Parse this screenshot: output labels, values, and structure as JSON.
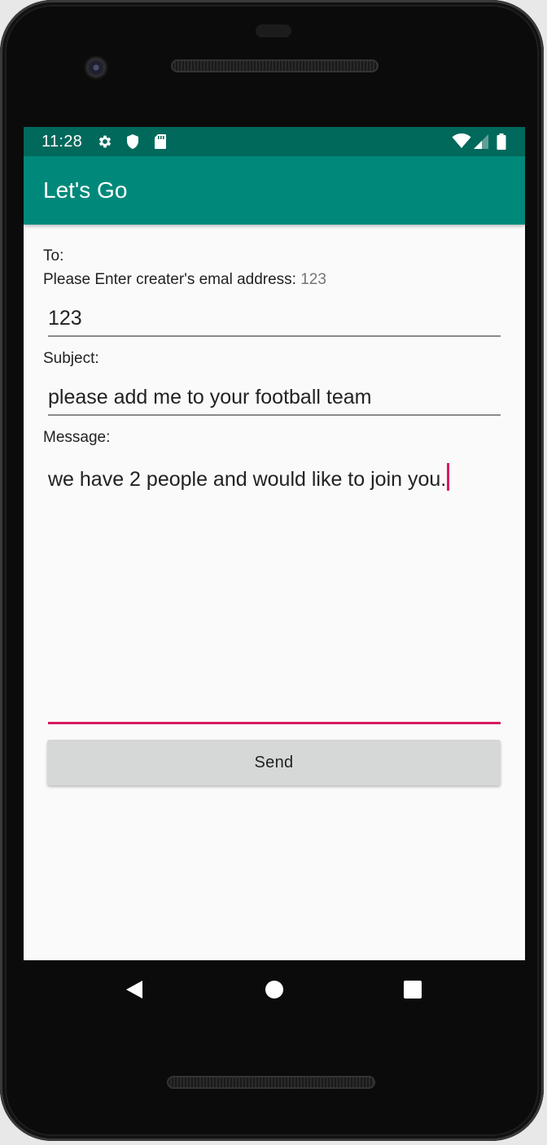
{
  "status_bar": {
    "time": "11:28",
    "left_icons": [
      "settings-icon",
      "shield-icon",
      "sd-card-icon"
    ],
    "right_icons": [
      "wifi-icon",
      "cell-signal-icon",
      "battery-icon"
    ]
  },
  "app_bar": {
    "title": "Let's Go"
  },
  "form": {
    "to_label": "To:",
    "prompt_label": "Please Enter creater's emal address:",
    "prompt_value": "123",
    "email_value": "123",
    "subject_label": "Subject:",
    "subject_value": "please add me to your football  team",
    "message_label": "Message:",
    "message_value": "we have 2 people and would like to join you.",
    "send_label": "Send"
  },
  "nav_bar": {
    "buttons": [
      "back-icon",
      "home-icon",
      "recents-icon"
    ]
  },
  "colors": {
    "status_bar": "#00695c",
    "app_bar": "#00897b",
    "accent": "#d81b60",
    "screen_bg": "#fafafa",
    "button_bg": "#d6d7d7"
  }
}
